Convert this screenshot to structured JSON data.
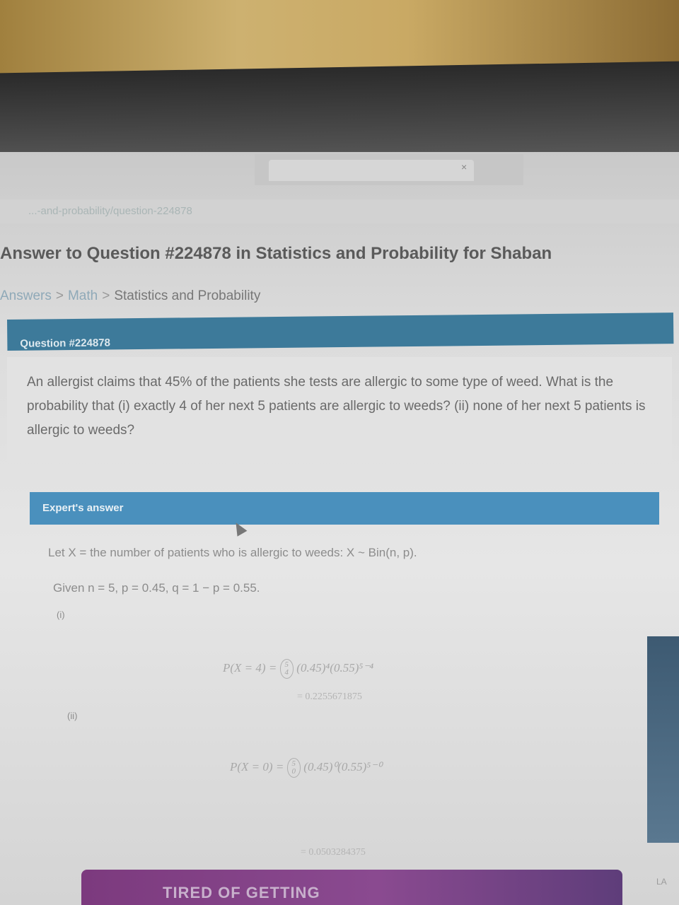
{
  "browser": {
    "url": "...-and-probability/question-224878",
    "tab_close": "×"
  },
  "page": {
    "title": "Answer to Question #224878 in Statistics and Probability for Shaban",
    "breadcrumb": [
      "Answers",
      "Math",
      "Statistics and Probability"
    ],
    "breadcrumb_sep": ">"
  },
  "question": {
    "header": "Question #224878",
    "text": "An allergist claims that 45% of the patients she tests are allergic to some type of weed. What is the probability that (i) exactly 4 of her next 5 patients are allergic to weeds? (ii) none of her next 5 patients is allergic to weeds?"
  },
  "answer": {
    "header": "Expert's answer",
    "let_line": "Let X = the number of patients who is allergic to weeds: X ~ Bin(n, p).",
    "given_line": "Given n = 5, p = 0.45, q = 1 − p = 0.55.",
    "part_i_label": "(i)",
    "formula_i_lhs": "P(X = 4) =",
    "binom_i_top": "5",
    "binom_i_bottom": "4",
    "formula_i_rhs": "(0.45)⁴(0.55)⁵⁻⁴",
    "result_i": "= 0.2255671875",
    "part_ii_label": "(ii)",
    "formula_ii_lhs": "P(X = 0) =",
    "binom_ii_top": "5",
    "binom_ii_bottom": "0",
    "formula_ii_rhs": "(0.45)⁰(0.55)⁵⁻⁰",
    "result_ii": "= 0.0503284375"
  },
  "side_panel": {
    "label": "LA"
  },
  "banner": {
    "text": "TIRED OF GETTING"
  }
}
